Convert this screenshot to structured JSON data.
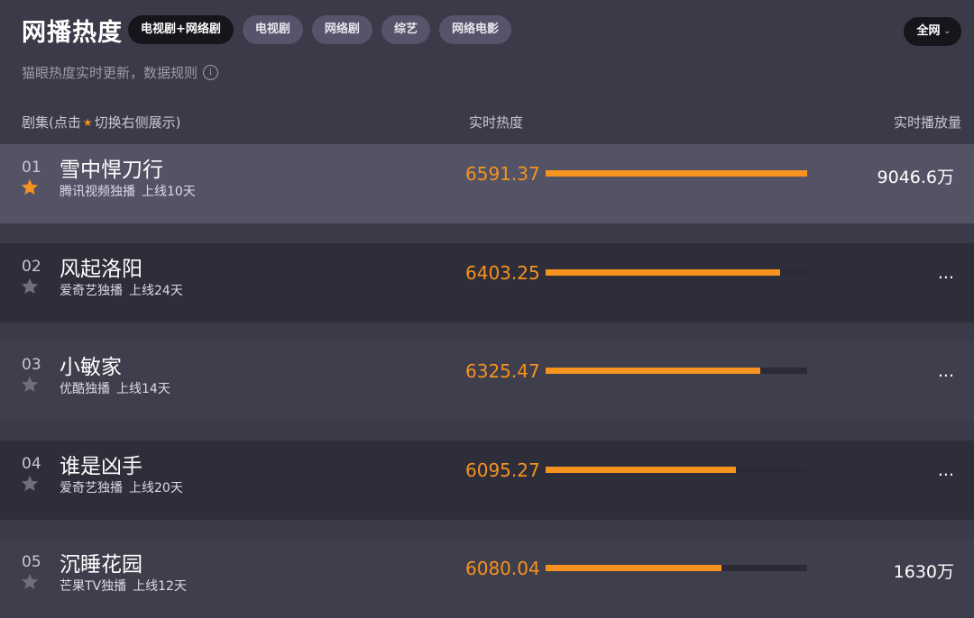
{
  "header": {
    "title": "网播热度",
    "subtitle": "猫眼热度实时更新，数据规则",
    "info_icon_glyph": "i",
    "region_select": {
      "value": "全网",
      "chevron": "⌄"
    }
  },
  "tabs": [
    {
      "label": "电视剧+网络剧",
      "active": true
    },
    {
      "label": "电视剧",
      "active": false
    },
    {
      "label": "网络剧",
      "active": false
    },
    {
      "label": "综艺",
      "active": false
    },
    {
      "label": "网络电影",
      "active": false
    }
  ],
  "columns": {
    "series_prefix": "剧集(点击",
    "series_star": "★",
    "series_suffix": "切换右侧展示)",
    "heat": "实时热度",
    "plays": "实时播放量"
  },
  "colors": {
    "accent": "#f6921e",
    "row_dark": "#2e2d3a",
    "row_light": "#3f3e4d",
    "row_selected": "#545366",
    "star_inactive": "#6f6e7d"
  },
  "rows": [
    {
      "rank": "01",
      "name": "雪中悍刀行",
      "platform": "腾讯视频独播",
      "days": "上线10天",
      "heat": "6591.37",
      "heat_fraction": 1.0,
      "plays": "9046.6万",
      "starred": true,
      "selected": true
    },
    {
      "rank": "02",
      "name": "风起洛阳",
      "platform": "爱奇艺独播",
      "days": "上线24天",
      "heat": "6403.25",
      "heat_fraction": 0.897,
      "plays": "...",
      "starred": false,
      "selected": false
    },
    {
      "rank": "03",
      "name": "小敏家",
      "platform": "优酷独播",
      "days": "上线14天",
      "heat": "6325.47",
      "heat_fraction": 0.821,
      "plays": "...",
      "starred": false,
      "selected": false
    },
    {
      "rank": "04",
      "name": "谁是凶手",
      "platform": "爱奇艺独播",
      "days": "上线20天",
      "heat": "6095.27",
      "heat_fraction": 0.728,
      "plays": "...",
      "starred": false,
      "selected": false
    },
    {
      "rank": "05",
      "name": "沉睡花园",
      "platform": "芒果TV独播",
      "days": "上线12天",
      "heat": "6080.04",
      "heat_fraction": 0.672,
      "plays": "1630万",
      "starred": false,
      "selected": false
    }
  ]
}
